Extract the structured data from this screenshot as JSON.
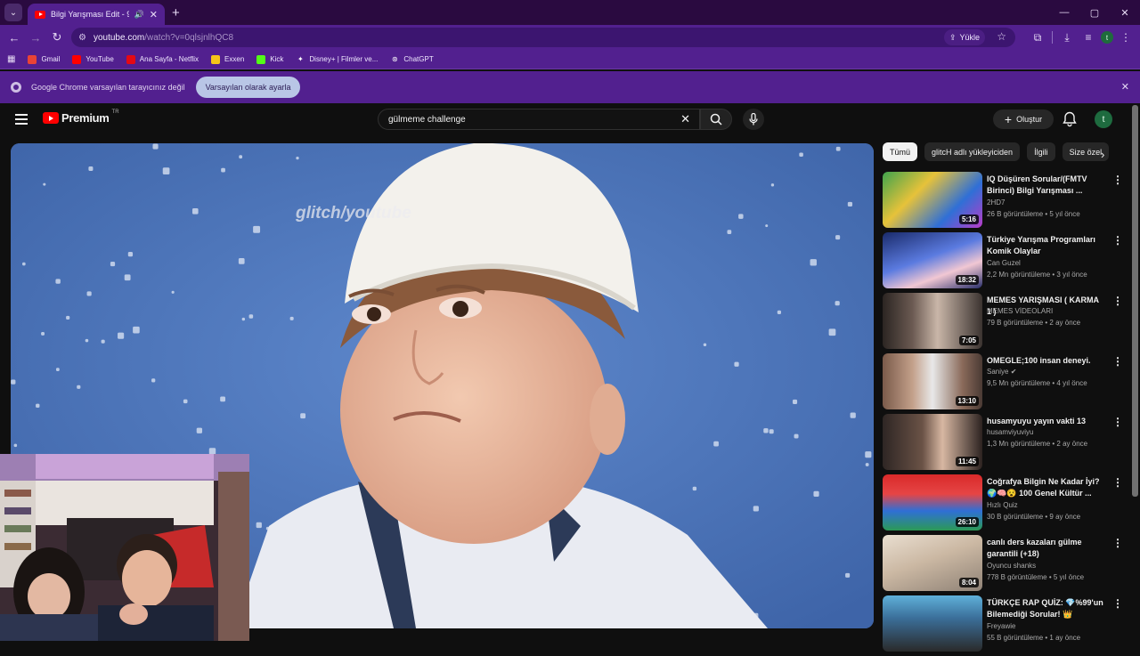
{
  "browser": {
    "tab": {
      "title": "Bilgi Yarışması Edit - 9 (Yeni"
    },
    "url_host": "youtube.com",
    "url_path": "/watch?v=0qlsjnlhQC8",
    "upload_label": "Yükle",
    "bookmarks": [
      {
        "label": "Gmail",
        "icon": "gmail-icon",
        "color": "#ea4335"
      },
      {
        "label": "YouTube",
        "icon": "youtube-icon",
        "color": "#ff0000"
      },
      {
        "label": "Ana Sayfa - Netflix",
        "icon": "netflix-icon",
        "color": "#e50914"
      },
      {
        "label": "Exxen",
        "icon": "exxen-icon",
        "color": "#f5c518"
      },
      {
        "label": "Kick",
        "icon": "kick-icon",
        "color": "#53fc18"
      },
      {
        "label": "Disney+ | Filmler ve...",
        "icon": "disney-icon",
        "color": "#4a5fd1"
      },
      {
        "label": "ChatGPT",
        "icon": "chatgpt-icon",
        "color": "#ffffff"
      }
    ],
    "infobar": {
      "text": "Google Chrome varsayılan tarayıcınız değil",
      "button": "Varsayılan olarak ayarla"
    },
    "accent_color": "#52208f"
  },
  "youtube": {
    "logo_text": "Premium",
    "logo_tm": "TR",
    "search_value": "gülmeme challenge",
    "create_label": "Oluştur",
    "avatar_letter": "t",
    "avatar_toolbar": "t",
    "player": {
      "watermark": "glitch/youtube"
    },
    "chips": [
      "Tümü",
      "glitcH adlı yükleyiciden",
      "İlgili",
      "Size özel"
    ],
    "recommendations": [
      {
        "title": "IQ Düşüren Sorular/(FMTV Birinci) Bilgi Yarışması ...",
        "channel": "2HD7",
        "meta": "26 B görüntüleme • 5 yıl önce",
        "duration": "5:16"
      },
      {
        "title": "Türkiye Yarışma Programları Komik Olaylar",
        "channel": "Can Guzel",
        "meta": "2,2 Mn görüntüleme • 3 yıl önce",
        "duration": "18:32"
      },
      {
        "title": "MEMES YARIŞMASI ( KARMA 1 )",
        "channel": "MEMES VİDEOLARI",
        "meta": "79 B görüntüleme • 2 ay önce",
        "duration": "7:05"
      },
      {
        "title": "OMEGLE;100 insan deneyi.",
        "channel": "Saniye",
        "meta": "9,5 Mn görüntüleme • 4 yıl önce",
        "duration": "13:10",
        "verified": true
      },
      {
        "title": "husamyuyu yayın vakti 13",
        "channel": "husamviyuviyu",
        "meta": "1,3 Mn görüntüleme • 2 ay önce",
        "duration": "11:45"
      },
      {
        "title": "Coğrafya Bilgin Ne Kadar İyi? 🌍🧠😵 100 Genel Kültür ...",
        "channel": "Hızlı Quiz",
        "meta": "30 B görüntüleme • 9 ay önce",
        "duration": "26:10"
      },
      {
        "title": "canlı ders kazaları gülme garantili (+18)",
        "channel": "Oyuncu shanks",
        "meta": "778 B görüntüleme • 5 yıl önce",
        "duration": "8:04"
      },
      {
        "title": "TÜRKÇE RAP QUİZ: 💎%99'un Bilemediği Sorular! 👑",
        "channel": "Freyawie",
        "meta": "55 B görüntüleme • 1 ay önce",
        "duration": ""
      }
    ]
  }
}
